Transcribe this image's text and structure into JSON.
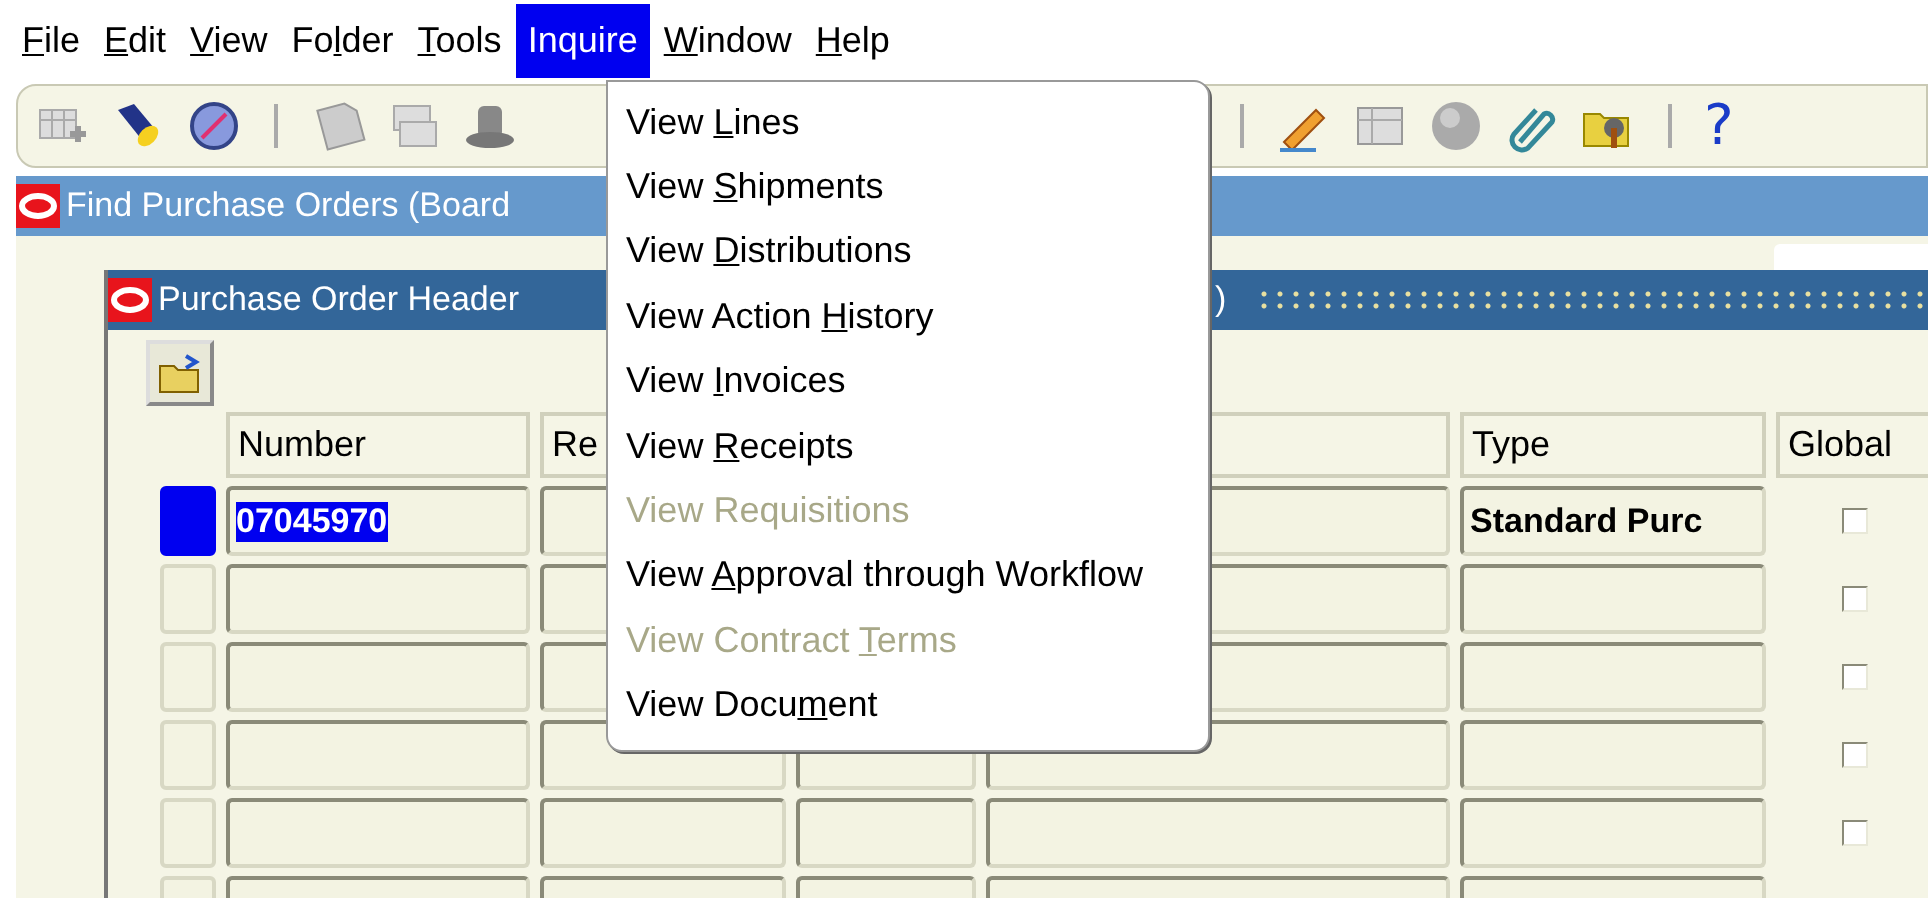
{
  "menu_bar": [
    {
      "mnemonic": "F",
      "after": "ile",
      "selected": false
    },
    {
      "mnemonic": "E",
      "after": "dit",
      "selected": false
    },
    {
      "mnemonic": "V",
      "after": "iew",
      "selected": false
    },
    {
      "before": "Fo",
      "mnemonic": "l",
      "after": "der",
      "selected": false
    },
    {
      "mnemonic": "T",
      "after": "ools",
      "selected": false
    },
    {
      "before": "Inquire",
      "selected": true
    },
    {
      "mnemonic": "W",
      "after": "indow",
      "selected": false
    },
    {
      "mnemonic": "H",
      "after": "elp",
      "selected": false
    }
  ],
  "toolbar": {
    "help": "?"
  },
  "window": {
    "title": "Find Purchase Orders (Board"
  },
  "inner_window": {
    "title": "Purchase Order Header",
    "title_end": ")"
  },
  "table": {
    "columns": {
      "number": "Number",
      "column_2": "Re",
      "type": "Type",
      "global": "Global"
    },
    "rows": [
      {
        "selected": true,
        "number": "07045970",
        "type": "Standard Purc",
        "global": false
      },
      {
        "selected": false,
        "global": false
      },
      {
        "selected": false,
        "global": false
      },
      {
        "selected": false,
        "global": false
      },
      {
        "selected": false,
        "global": false
      },
      {
        "selected": false
      }
    ]
  },
  "inquire_menu": [
    {
      "before": "View ",
      "mnemonic": "L",
      "after": "ines",
      "disabled": false
    },
    {
      "before": "View ",
      "mnemonic": "S",
      "after": "hipments",
      "disabled": false
    },
    {
      "before": "View ",
      "mnemonic": "D",
      "after": "istributions",
      "disabled": false
    },
    {
      "before": "View Action ",
      "mnemonic": "H",
      "after": "istory",
      "disabled": false
    },
    {
      "before": "View ",
      "mnemonic": "I",
      "after": "nvoices",
      "disabled": false
    },
    {
      "before": "View ",
      "mnemonic": "R",
      "after": "eceipts",
      "disabled": false
    },
    {
      "before": "View Requisitions",
      "disabled": true
    },
    {
      "before": "View ",
      "mnemonic": "A",
      "after": "pproval through Workflow",
      "disabled": false
    },
    {
      "before": "View Contract ",
      "mnemonic": "T",
      "after": "erms",
      "disabled": true
    },
    {
      "before": "View Docu",
      "mnemonic": "m",
      "after": "ent",
      "disabled": false
    }
  ]
}
